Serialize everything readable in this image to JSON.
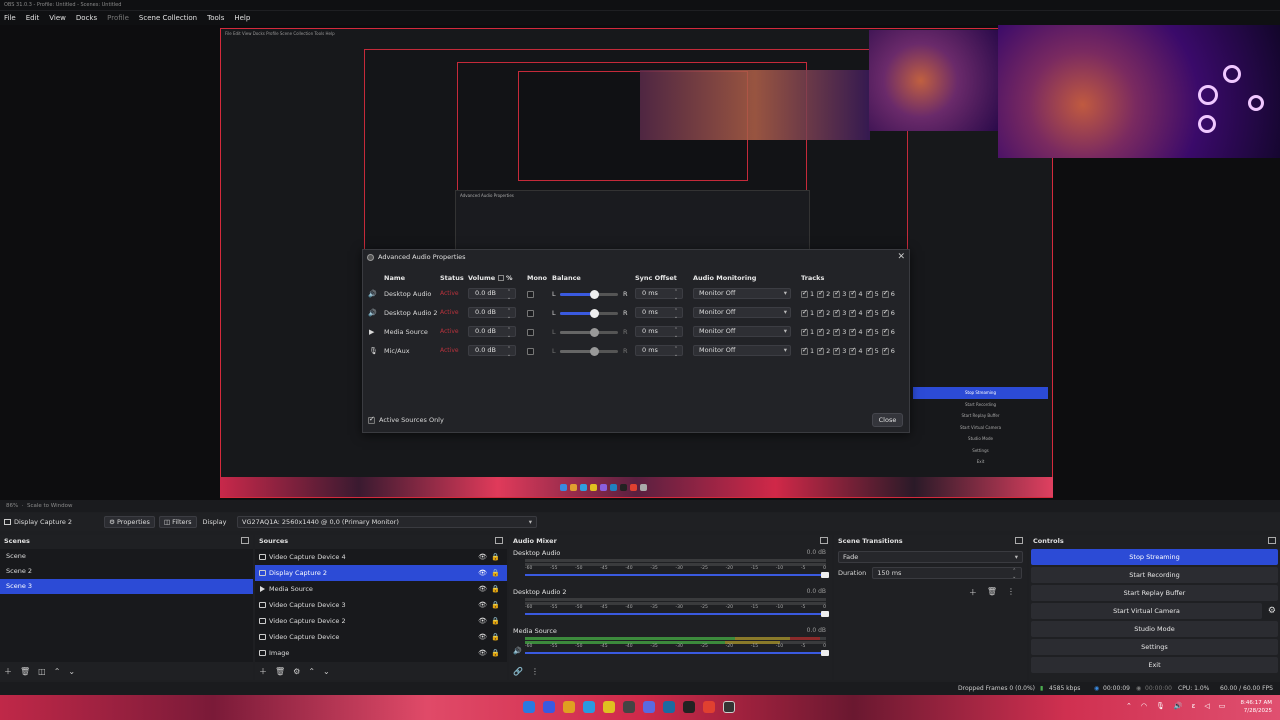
{
  "window": {
    "title": "OBS 31.0.3 - Profile: Untitled - Scenes: Untitled"
  },
  "menu": [
    "File",
    "Edit",
    "View",
    "Docks",
    "Profile",
    "Scene Collection",
    "Tools",
    "Help"
  ],
  "dialog": {
    "title": "Advanced Audio Properties",
    "headers": {
      "name": "Name",
      "status": "Status",
      "volume": "Volume",
      "percent": "%",
      "mono": "Mono",
      "balance": "Balance",
      "sync": "Sync Offset",
      "monitoring": "Audio Monitoring",
      "tracks": "Tracks"
    },
    "rows": [
      {
        "name": "Desktop Audio",
        "status": "Active",
        "volume": "0.0 dB",
        "balance_l": "L",
        "balance_r": "R",
        "sync": "0 ms",
        "monitoring": "Monitor Off"
      },
      {
        "name": "Desktop Audio 2",
        "status": "Active",
        "volume": "0.0 dB",
        "balance_l": "L",
        "balance_r": "R",
        "sync": "0 ms",
        "monitoring": "Monitor Off"
      },
      {
        "name": "Media Source",
        "status": "Active",
        "volume": "0.0 dB",
        "balance_l": "L",
        "balance_r": "R",
        "sync": "0 ms",
        "monitoring": "Monitor Off"
      },
      {
        "name": "Mic/Aux",
        "status": "Active",
        "volume": "0.0 dB",
        "balance_l": "L",
        "balance_r": "R",
        "sync": "0 ms",
        "monitoring": "Monitor Off"
      }
    ],
    "track_numbers": [
      "1",
      "2",
      "3",
      "4",
      "5",
      "6"
    ],
    "active_sources_only": "Active Sources Only",
    "close": "Close"
  },
  "preview_status": {
    "zoom": "86%",
    "scale": "Scale to Window"
  },
  "contextbar": {
    "source": "Display Capture 2",
    "properties": "Properties",
    "filters": "Filters",
    "display_label": "Display",
    "display_value": "VG27AQ1A: 2560x1440 @ 0,0 (Primary Monitor)"
  },
  "scenes": {
    "title": "Scenes",
    "items": [
      "Scene",
      "Scene 2",
      "Scene 3"
    ]
  },
  "sources": {
    "title": "Sources",
    "items": [
      "Video Capture Device 4",
      "Display Capture 2",
      "Media Source",
      "Video Capture Device 3",
      "Video Capture Device 2",
      "Video Capture Device",
      "Image"
    ]
  },
  "mixer": {
    "title": "Audio Mixer",
    "channels": [
      {
        "name": "Desktop Audio",
        "db": "0.0 dB"
      },
      {
        "name": "Desktop Audio 2",
        "db": "0.0 dB"
      },
      {
        "name": "Media Source",
        "db": "0.0 dB"
      }
    ],
    "ticks": [
      "-60",
      "-55",
      "-50",
      "-45",
      "-40",
      "-35",
      "-30",
      "-25",
      "-20",
      "-15",
      "-10",
      "-5",
      "0"
    ]
  },
  "transitions": {
    "title": "Scene Transitions",
    "type": "Fade",
    "duration_label": "Duration",
    "duration_value": "150 ms"
  },
  "controls": {
    "title": "Controls",
    "stop_streaming": "Stop Streaming",
    "start_recording": "Start Recording",
    "start_replay": "Start Replay Buffer",
    "start_virtual": "Start Virtual Camera",
    "studio_mode": "Studio Mode",
    "settings": "Settings",
    "exit": "Exit"
  },
  "status": {
    "dropped": "Dropped Frames 0 (0.0%)",
    "kbps": "4585 kbps",
    "stream_time": "00:00:09",
    "rec_time": "00:00:00",
    "cpu": "CPU: 1.0%",
    "fps": "60.00 / 60.00 FPS"
  },
  "clock": {
    "time": "8:46:17 AM",
    "date": "7/28/2025"
  }
}
